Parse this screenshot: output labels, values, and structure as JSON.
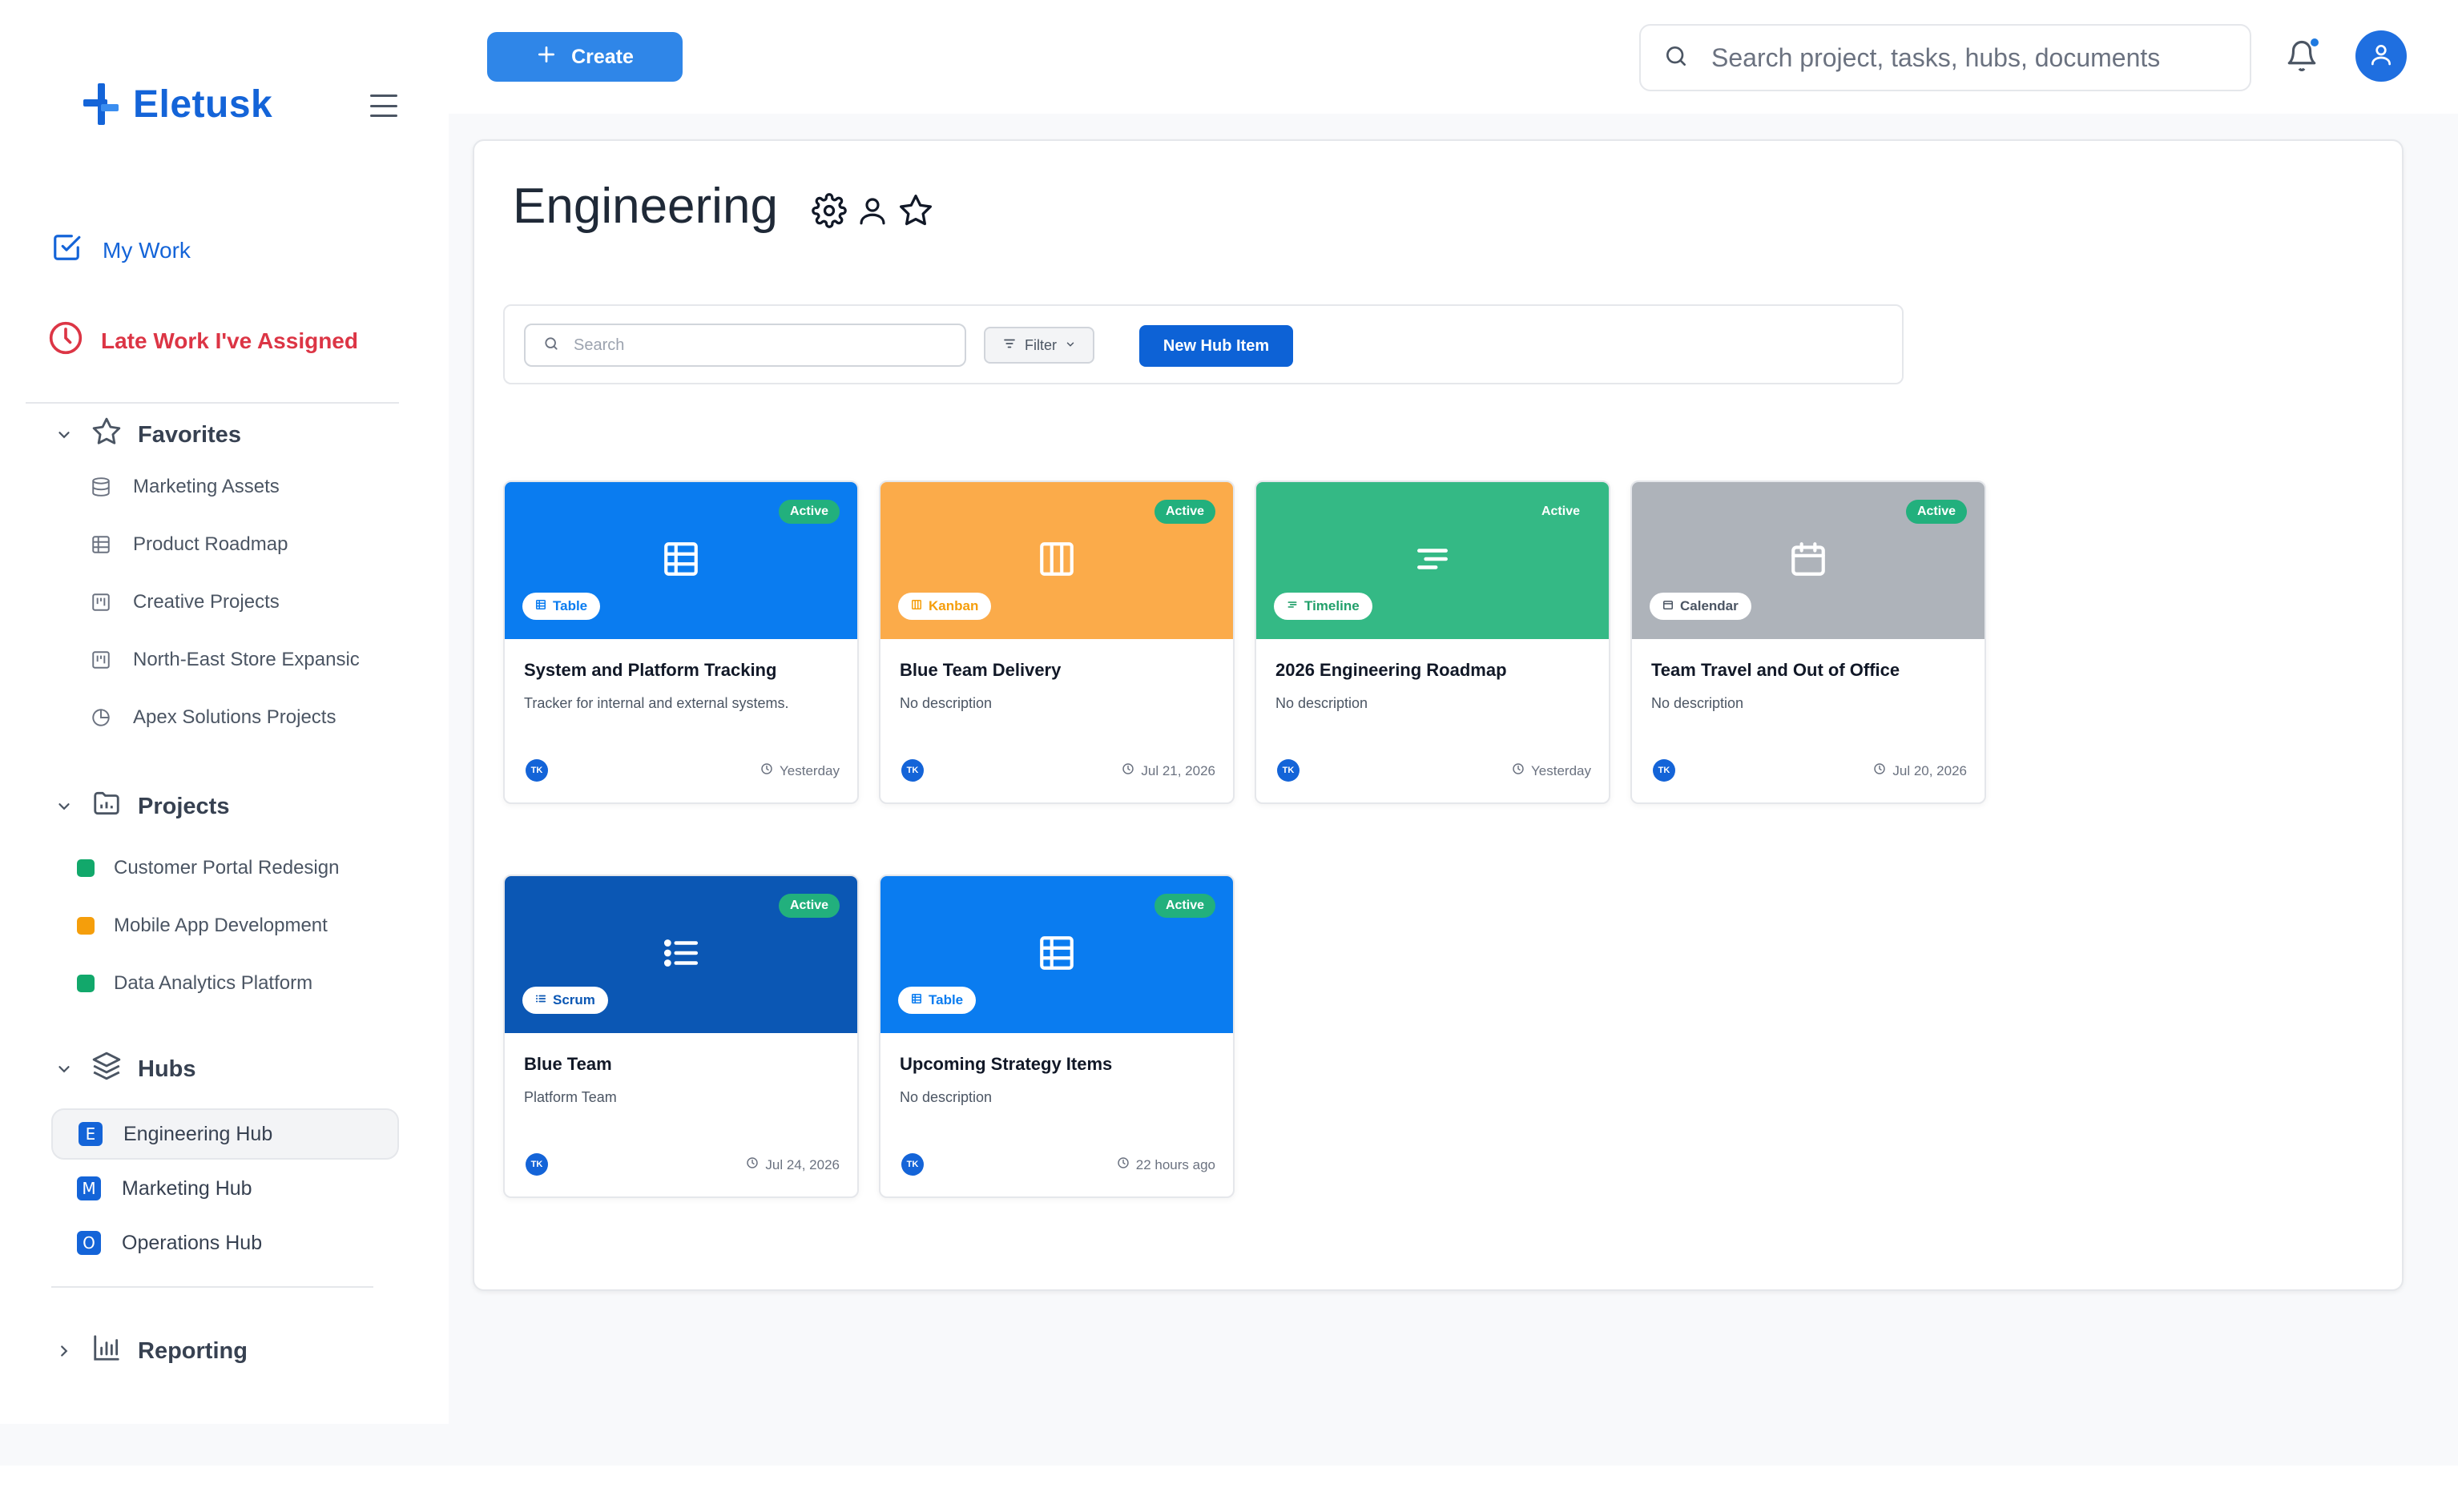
{
  "app": {
    "name": "Eletusk"
  },
  "topbar": {
    "create_label": "Create",
    "search_placeholder": "Search project, tasks, hubs, documents"
  },
  "sidebar": {
    "my_work": "My Work",
    "late_work": "Late Work I've Assigned",
    "favorites": {
      "label": "Favorites",
      "items": [
        {
          "label": "Marketing Assets",
          "icon": "database-icon"
        },
        {
          "label": "Product Roadmap",
          "icon": "table-icon"
        },
        {
          "label": "Creative Projects",
          "icon": "kanban-icon"
        },
        {
          "label": "North-East Store Expansic",
          "icon": "kanban-icon"
        },
        {
          "label": "Apex Solutions Projects",
          "icon": "pie-chart-icon"
        }
      ]
    },
    "projects": {
      "label": "Projects",
      "items": [
        {
          "label": "Customer Portal Redesign",
          "color": "#12a86b"
        },
        {
          "label": "Mobile App Development",
          "color": "#f59e0b"
        },
        {
          "label": "Data Analytics Platform",
          "color": "#12a86b"
        }
      ]
    },
    "hubs": {
      "label": "Hubs",
      "items": [
        {
          "letter": "E",
          "label": "Engineering Hub",
          "active": true
        },
        {
          "letter": "M",
          "label": "Marketing Hub",
          "active": false
        },
        {
          "letter": "O",
          "label": "Operations Hub",
          "active": false
        }
      ]
    },
    "reporting": "Reporting"
  },
  "page": {
    "title": "Engineering",
    "search_placeholder": "Search",
    "filter_label": "Filter",
    "new_item_label": "New Hub Item"
  },
  "cards": [
    {
      "title": "System and Platform Tracking",
      "desc": "Tracker for internal and external systems.",
      "type": "Table",
      "status": "Active",
      "date": "Yesterday",
      "avatar": "TK",
      "color": "#0a7cf0",
      "type_color": "#0a7cf0",
      "icon": "table-icon"
    },
    {
      "title": "Blue Team Delivery",
      "desc": "No description",
      "type": "Kanban",
      "status": "Active",
      "date": "Jul 21, 2026",
      "avatar": "TK",
      "color": "#fbab4a",
      "type_color": "#f59e0b",
      "icon": "kanban-icon"
    },
    {
      "title": "2026 Engineering Roadmap",
      "desc": "No description",
      "type": "Timeline",
      "status": "Active",
      "date": "Yesterday",
      "avatar": "TK",
      "color": "#34b985",
      "type_color": "#22a06b",
      "icon": "timeline-icon"
    },
    {
      "title": "Team Travel and Out of Office",
      "desc": "No description",
      "type": "Calendar",
      "status": "Active",
      "date": "Jul 20, 2026",
      "avatar": "TK",
      "color": "#aeb3ba",
      "type_color": "#4b5563",
      "icon": "calendar-icon"
    },
    {
      "title": "Blue Team",
      "desc": "Platform Team",
      "type": "Scrum",
      "status": "Active",
      "date": "Jul 24, 2026",
      "avatar": "TK",
      "color": "#0b57b4",
      "type_color": "#0b57b4",
      "icon": "list-icon"
    },
    {
      "title": "Upcoming Strategy Items",
      "desc": "No description",
      "type": "Table",
      "status": "Active",
      "date": "22 hours ago",
      "avatar": "TK",
      "color": "#0a7cf0",
      "type_color": "#0a7cf0",
      "icon": "table-icon"
    }
  ]
}
